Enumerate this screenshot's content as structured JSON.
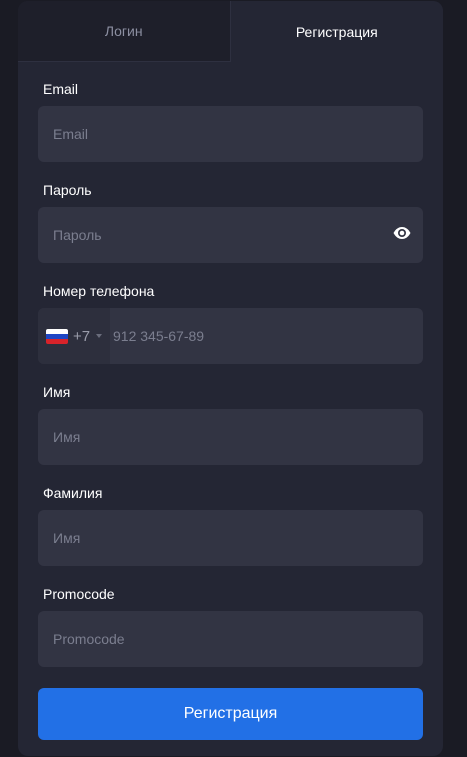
{
  "tabs": {
    "login": "Логин",
    "register": "Регистрация",
    "active": "register"
  },
  "form": {
    "email": {
      "label": "Email",
      "placeholder": "Email",
      "value": ""
    },
    "password": {
      "label": "Пароль",
      "placeholder": "Пароль",
      "value": "",
      "toggle_icon": "eye-icon"
    },
    "phone": {
      "label": "Номер телефона",
      "country_flag": "flag-ru-icon",
      "dial_code": "+7",
      "placeholder": "912 345-67-89",
      "value": ""
    },
    "first_name": {
      "label": "Имя",
      "placeholder": "Имя",
      "value": ""
    },
    "last_name": {
      "label": "Фамилия",
      "placeholder": "Имя",
      "value": ""
    },
    "promocode": {
      "label": "Promocode",
      "placeholder": "Promocode",
      "value": ""
    }
  },
  "submit_label": "Регистрация",
  "colors": {
    "background": "#1a1b24",
    "panel": "#242634",
    "input": "#323443",
    "accent": "#2270e6"
  }
}
